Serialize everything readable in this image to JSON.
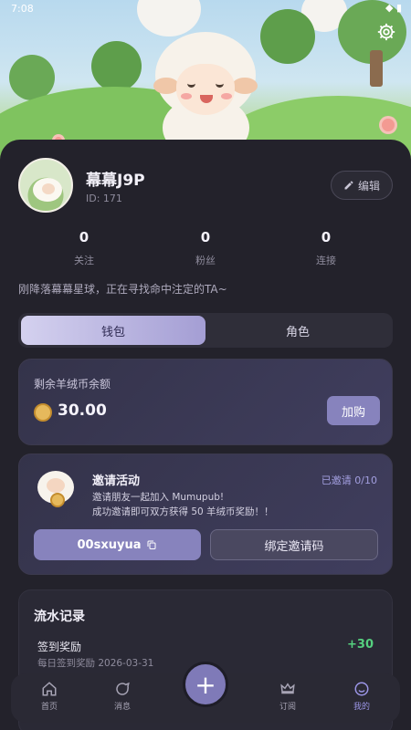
{
  "status_bar": {
    "time": "7:08",
    "icons": "◆ ▮"
  },
  "profile": {
    "username": "幕幕J9P",
    "id_text": "ID: 171",
    "edit_label": "编辑",
    "bio": "刚降落幕幕星球，正在寻找命中注定的TA~"
  },
  "stats": [
    {
      "value": "0",
      "label": "关注"
    },
    {
      "value": "0",
      "label": "粉丝"
    },
    {
      "value": "0",
      "label": "连接"
    }
  ],
  "tabs": {
    "wallet": "钱包",
    "role": "角色"
  },
  "wallet": {
    "title": "剩余羊绒币余额",
    "amount": "30.00",
    "buy_label": "加购"
  },
  "invite": {
    "title": "邀请活动",
    "status": "已邀请 0/10",
    "desc_line1": "邀请朋友一起加入 Mumupub!",
    "desc_line2": "成功邀请即可双方获得 50 羊绒币奖励！！",
    "code": "00sxuyua",
    "bind_label": "绑定邀请码"
  },
  "records": {
    "title": "流水记录",
    "items": [
      {
        "name": "签到奖励",
        "date": "每日签到奖励 2026-03-31",
        "amount": "+30"
      }
    ]
  },
  "nav": {
    "home": "首页",
    "messages": "消息",
    "subscribe": "订阅",
    "mine": "我的",
    "add": "+"
  },
  "colors": {
    "accent": "#8783bd",
    "positive": "#55d07f",
    "background": "#23222b"
  }
}
